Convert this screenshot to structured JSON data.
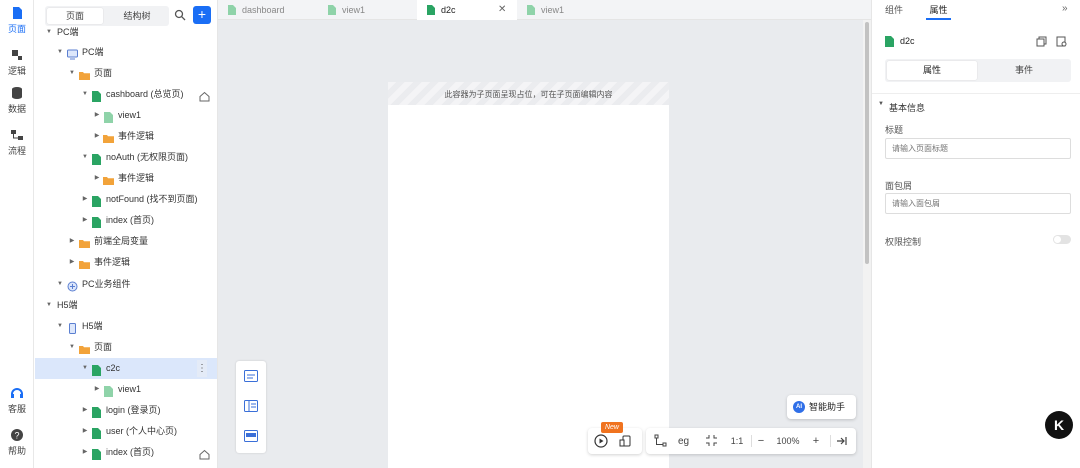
{
  "rail": {
    "items": [
      {
        "label": "页面",
        "icon": "page-icon",
        "active": true
      },
      {
        "label": "逻辑",
        "icon": "logic-icon"
      },
      {
        "label": "数据",
        "icon": "database-icon"
      },
      {
        "label": "流程",
        "icon": "flow-icon"
      }
    ],
    "bottom": [
      {
        "label": "客服",
        "icon": "headset-icon"
      },
      {
        "label": "帮助",
        "icon": "help-icon"
      }
    ]
  },
  "tree": {
    "tabs": [
      {
        "label": "页面",
        "active": true
      },
      {
        "label": "结构树"
      }
    ],
    "add_label": "+",
    "nodes": [
      {
        "label": "PC端",
        "icon": "none",
        "arrow": "▼"
      },
      {
        "label": "PC端",
        "icon": "monitor-icon",
        "arrow": "▼"
      },
      {
        "label": "页面",
        "icon": "folder-icon",
        "arrow": "▼"
      },
      {
        "label": "cashboard (总览页)",
        "icon": "page-file-icon",
        "arrow": "▼",
        "trail": "home-icon"
      },
      {
        "label": "view1",
        "icon": "page-file-light-icon",
        "arrow": "▶"
      },
      {
        "label": "事件逻辑",
        "icon": "folder-icon",
        "arrow": "▶"
      },
      {
        "label": "noAuth (无权限页面)",
        "icon": "page-file-icon",
        "arrow": "▼"
      },
      {
        "label": "事件逻辑",
        "icon": "folder-icon",
        "arrow": "▶"
      },
      {
        "label": "notFound (找不到页面)",
        "icon": "page-file-icon",
        "arrow": "▶"
      },
      {
        "label": "index (首页)",
        "icon": "page-file-icon",
        "arrow": "▶"
      },
      {
        "label": "前端全局变量",
        "icon": "folder-icon",
        "arrow": "▶"
      },
      {
        "label": "事件逻辑",
        "icon": "folder-icon",
        "arrow": "▶"
      },
      {
        "label": "PC业务组件",
        "icon": "component-icon",
        "arrow": "▼"
      },
      {
        "label": "H5端",
        "icon": "none",
        "arrow": "▼"
      },
      {
        "label": "H5端",
        "icon": "phone-icon",
        "arrow": "▼"
      },
      {
        "label": "页面",
        "icon": "folder-icon",
        "arrow": "▼"
      },
      {
        "label": "c2c",
        "icon": "page-file-icon",
        "arrow": "▼",
        "selected": true,
        "more": "⋮"
      },
      {
        "label": "view1",
        "icon": "page-file-light-icon",
        "arrow": "▶"
      },
      {
        "label": "login (登录页)",
        "icon": "page-file-icon",
        "arrow": "▶"
      },
      {
        "label": "user (个人中心页)",
        "icon": "page-file-icon",
        "arrow": "▶"
      },
      {
        "label": "index (首页)",
        "icon": "page-file-icon",
        "arrow": "▶",
        "trail": "home-icon"
      }
    ]
  },
  "doc_tabs": [
    {
      "label": "dashboard"
    },
    {
      "label": "view1"
    },
    {
      "label": "d2c",
      "active": true,
      "close": "✕"
    },
    {
      "label": "view1"
    }
  ],
  "canvas": {
    "banner": "此容器为子页面呈现占位，可在子页面编辑内容",
    "ai_label": "智能助手",
    "ai_badge": "AI",
    "new_badge": "New",
    "zoom": {
      "ratio": "1:1",
      "minus": "−",
      "value": "100%",
      "plus": "+"
    }
  },
  "right": {
    "tabs": [
      {
        "label": "组件"
      },
      {
        "label": "属性",
        "active": true
      }
    ],
    "collapse": "»",
    "component_name": "d2c",
    "switch": [
      {
        "label": "属性",
        "active": true
      },
      {
        "label": "事件"
      }
    ],
    "section": "基本信息",
    "fields": [
      {
        "label": "标题",
        "placeholder": "请输入页面标题"
      },
      {
        "label": "面包屑",
        "placeholder": "请输入面包屑"
      }
    ],
    "permission_label": "权限控制",
    "permission_on": false
  },
  "colors": {
    "accent": "#1a6ef5",
    "folder": "#f2a33a",
    "page": "#2aa463",
    "selected": "#dbe7fb"
  }
}
